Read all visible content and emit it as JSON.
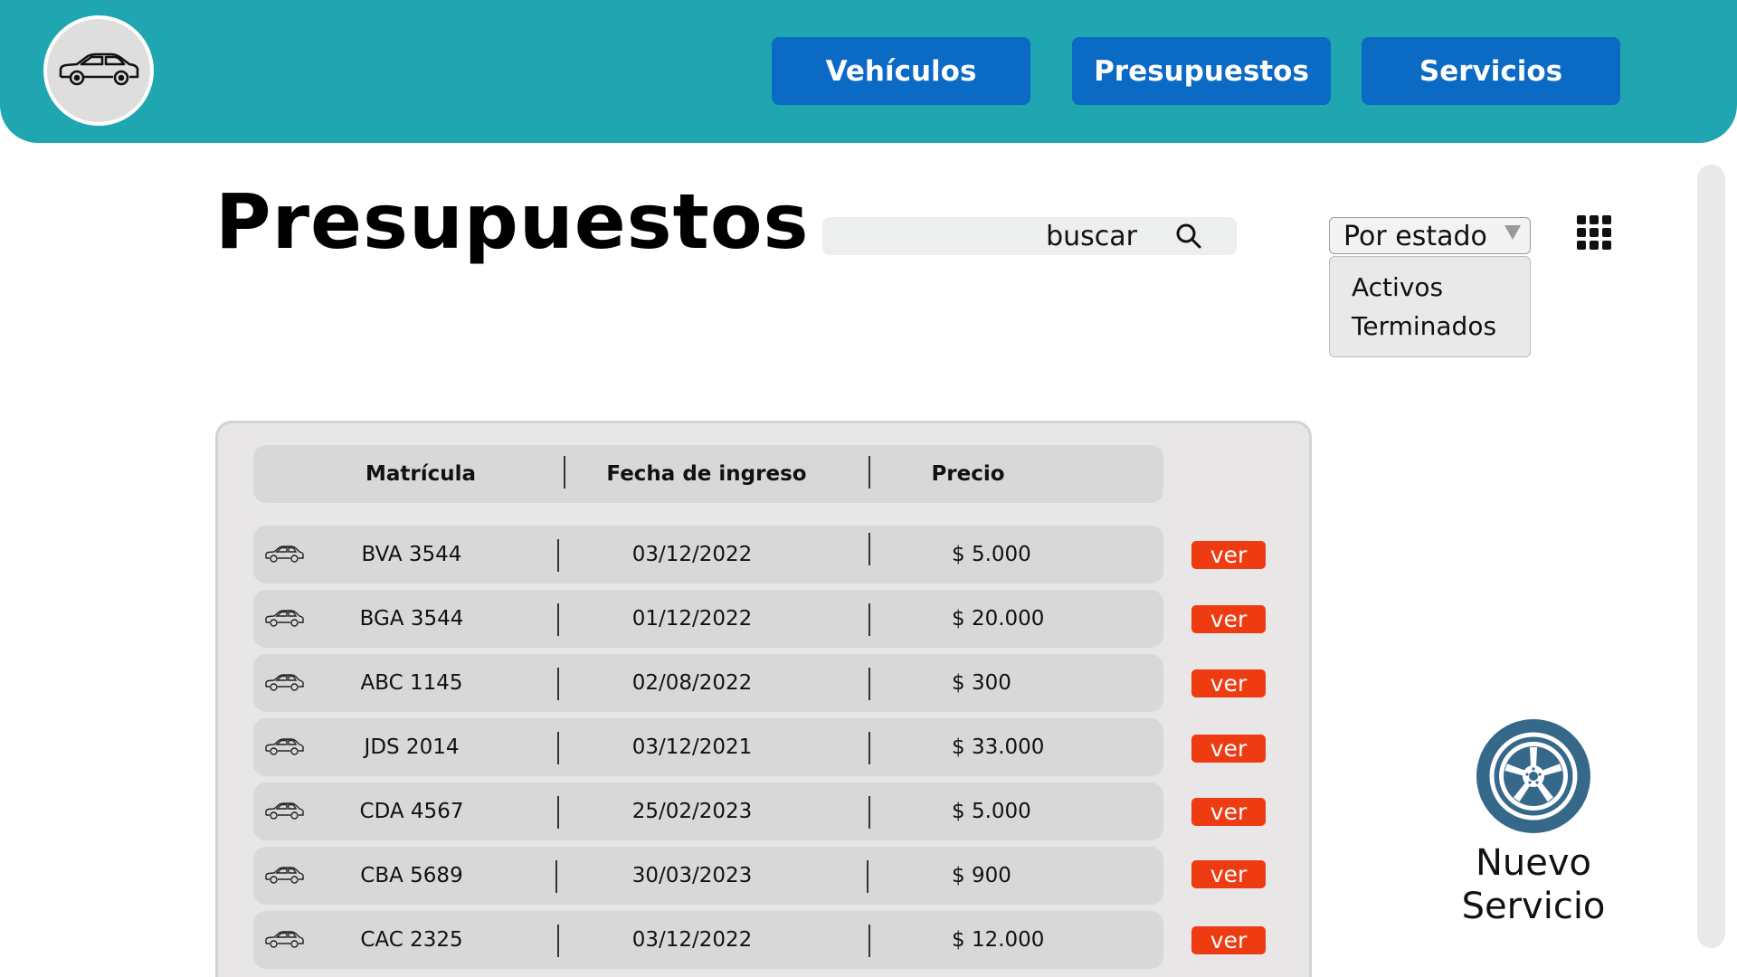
{
  "nav": {
    "logo_icon": "car-icon",
    "items": [
      {
        "label": "Vehículos"
      },
      {
        "label": "Presupuestos"
      },
      {
        "label": "Servicios"
      }
    ]
  },
  "page": {
    "title": "Presupuestos"
  },
  "search": {
    "placeholder": "buscar",
    "icon": "search-icon"
  },
  "filter": {
    "selected": "Por estado",
    "options": [
      "Activos",
      "Terminados"
    ]
  },
  "table": {
    "headers": [
      "Matrícula",
      "Fecha de ingreso",
      "Precio"
    ],
    "action_label": "ver",
    "rows": [
      {
        "plate": "BVA 3544",
        "date": "03/12/2022",
        "price": "$ 5.000"
      },
      {
        "plate": "BGA 3544",
        "date": "01/12/2022",
        "price": "$ 20.000"
      },
      {
        "plate": "ABC 1145",
        "date": "02/08/2022",
        "price": "$ 300"
      },
      {
        "plate": "JDS 2014",
        "date": "03/12/2021",
        "price": "$ 33.000"
      },
      {
        "plate": "CDA 4567",
        "date": "25/02/2023",
        "price": "$ 5.000"
      },
      {
        "plate": "CBA 5689",
        "date": "30/03/2023",
        "price": "$ 900"
      },
      {
        "plate": "CAC 2325",
        "date": "03/12/2022",
        "price": "$ 12.000"
      }
    ]
  },
  "new_service": {
    "label_line1": "Nuevo",
    "label_line2": "Servicio",
    "icon": "wheel-icon"
  },
  "colors": {
    "header": "#1fa6b0",
    "nav_button": "#0a6ac4",
    "action_button": "#ee3b12",
    "fab": "#36688a"
  }
}
